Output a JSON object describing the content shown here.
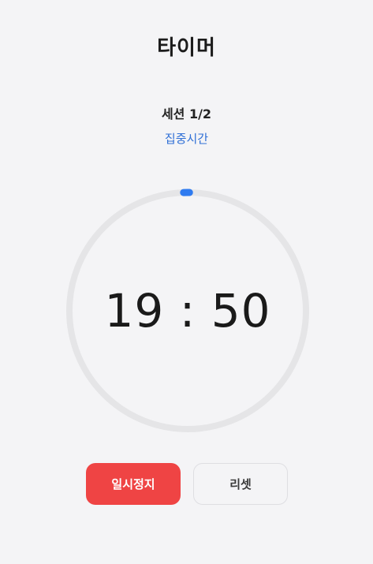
{
  "header": {
    "title": "타이머"
  },
  "session": {
    "label": "세션 1/2",
    "phase": "집중시간"
  },
  "timer": {
    "display": "19 : 50",
    "progress": 0.008,
    "ring_color": "#e5e5e7",
    "progress_color": "#2f7bf0"
  },
  "controls": {
    "pause_label": "일시정지",
    "reset_label": "리셋",
    "pause_color": "#ef4444"
  }
}
